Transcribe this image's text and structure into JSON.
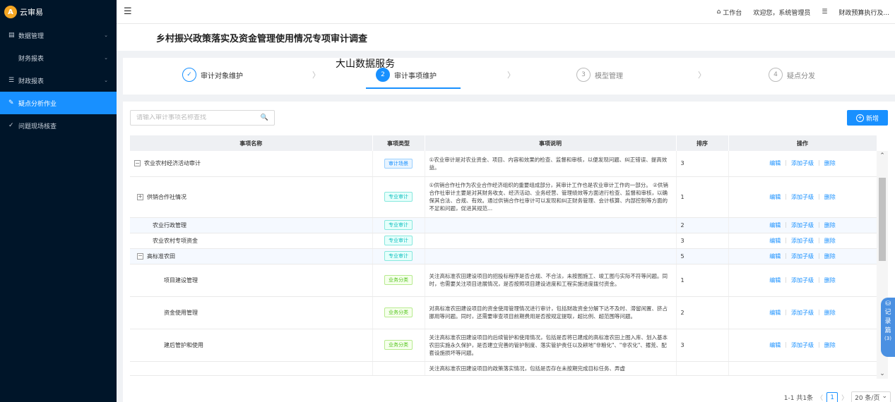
{
  "app": {
    "name": "云审易",
    "logo_letter": "A"
  },
  "sidebar": {
    "items": [
      {
        "label": "数据管理",
        "icon": "list-icon",
        "glyph": "▤",
        "has_children": true
      },
      {
        "label": "财务报表",
        "icon": "",
        "glyph": "",
        "has_children": true
      },
      {
        "label": "财政报表",
        "icon": "list-icon",
        "glyph": "☰",
        "has_children": true
      },
      {
        "label": "疑点分析作业",
        "icon": "analysis-icon",
        "glyph": "✎",
        "active": true
      },
      {
        "label": "问题现场核查",
        "icon": "check-icon",
        "glyph": "✓"
      }
    ]
  },
  "header": {
    "collapse_glyph": "☰",
    "workbench": "工作台",
    "welcome": "欢迎您，系统管理员",
    "menu_glyph": "☰",
    "report": "财政预算执行及..."
  },
  "page": {
    "title": "乡村振兴政策落实及资金管理使用情况专项审计调查"
  },
  "watermark": "大山数据服务",
  "steps": [
    {
      "number": "✓",
      "label": "审计对象维护",
      "state": "done"
    },
    {
      "number": "2",
      "label": "审计事项维护",
      "state": "current"
    },
    {
      "number": "3",
      "label": "模型管理",
      "state": "pending"
    },
    {
      "number": "4",
      "label": "疑点分发",
      "state": "pending"
    }
  ],
  "search": {
    "placeholder": "请输入审计事项名称查找",
    "value": ""
  },
  "add_button": {
    "label": "新增"
  },
  "table": {
    "headers": {
      "name": "事项名称",
      "type": "事项类型",
      "desc": "事项说明",
      "order": "排序",
      "ops": "操作"
    },
    "ops": {
      "edit": "编辑",
      "add_child": "添加子级",
      "delete": "删除"
    },
    "rows": [
      {
        "name": "农业农村经济活动审计",
        "level": 0,
        "expander": "−",
        "type": "审计场景",
        "type_style": "scene",
        "desc": "①农业审计是对农业资金、项目、内容和效果的检查、监督和审核，以便发现问题、纠正错误、提高效益。",
        "order": "3",
        "highlight": false
      },
      {
        "name": "供销合作社情况",
        "level": 1,
        "expander": "+",
        "type": "专业审计",
        "type_style": "pro",
        "desc": "①供销合作社作为农业合作经济组织的重要组成部分，其审计工作也是农业审计工作的一部分。 ②供销合作社审计主要是对其财务收支、经济活动、业务经营、管理绩效等方面进行检查、监督和审核，以确保其合法、合规、有效。通过供销合作社审计可以发现和纠正财务管理、会计核算、内部控制等方面的不足和问题，促进其规范...",
        "order": "1",
        "highlight": false
      },
      {
        "name": "农业行政管理",
        "level": 2,
        "expander": "",
        "type": "专业审计",
        "type_style": "pro",
        "desc": "",
        "order": "2",
        "highlight": true
      },
      {
        "name": "农业农村专项资金",
        "level": 2,
        "expander": "",
        "type": "专业审计",
        "type_style": "pro",
        "desc": "",
        "order": "3",
        "highlight": false
      },
      {
        "name": "高标准农田",
        "level": 1,
        "expander": "−",
        "type": "专业审计",
        "type_style": "pro",
        "desc": "",
        "order": "5",
        "highlight": true
      },
      {
        "name": "项目建设管理",
        "level": 3,
        "expander": "",
        "type": "业务分类",
        "type_style": "biz",
        "desc": "关注高标准农田建设项目的招投标程序是否合规、不合法，未按图施工、竣工图与实际不符等问题。同时，也需要关注项目进展情况，是否按照项目建设进度和工程实施进度拨付资金。",
        "order": "1",
        "highlight": false
      },
      {
        "name": "资金使用管理",
        "level": 3,
        "expander": "",
        "type": "业务分类",
        "type_style": "biz",
        "desc": "对高标准农田建设项目的资金使用管理情况进行审计，包括财政资金分解下达不及时、滞留闲置、挤占挪用等问题。同时，还需要审查项目前期费用是否按规定提取，超比例、超范围等问题。",
        "order": "2",
        "highlight": false
      },
      {
        "name": "建后管护和使用",
        "level": 3,
        "expander": "",
        "type": "业务分类",
        "type_style": "biz",
        "desc": "关注高标准农田建设项目的后续管护和使用情况，包括是否将已建成的高标准农田上图入库、划入基本农田实施永久保护，是否建立完善的管护制度、落实管护责任以及耕地\"非粮化\"、\"非农化\"、撂荒、配套设施损坏等问题。",
        "order": "3",
        "highlight": false
      },
      {
        "name": "",
        "level": 3,
        "expander": "",
        "type": "",
        "type_style": "",
        "desc": "关注高标准农田建设项目的政策落实情况，包括是否存在未按期完成目标任务、弄虚",
        "order": "",
        "highlight": false
      }
    ]
  },
  "pagination": {
    "summary": "1-1 共1条",
    "current": "1",
    "page_size": "20 条/页"
  },
  "record_widget": {
    "glyph": "⛁",
    "chars": [
      "记",
      "录",
      "篇"
    ],
    "count": "(3)"
  }
}
